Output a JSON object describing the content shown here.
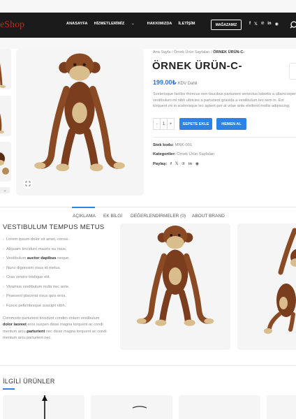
{
  "header": {
    "logo": "eShop",
    "nav": [
      "ANASAYFA",
      "HİZMETLERİMİZ",
      "HAKKIMIZDA",
      "İLETİŞİM"
    ],
    "nav_caret": "⌄",
    "store_button": "MAĞAZAMIZ",
    "socials": [
      "f",
      "𝕏",
      "℗",
      "in",
      "◉"
    ]
  },
  "breadcrumb": {
    "home": "Ana Sayfa",
    "sep1": " / ",
    "category": "Örnek Ürün Sayfaları",
    "sep2": " / ",
    "current": "ÖRNEK ÜRÜN-C-"
  },
  "product": {
    "title": "ÖRNEK ÜRÜN-C-",
    "price": "199.00₺",
    "tax_note": "KDV Dahil",
    "description_lines": [
      "Scelerisque facilisi rhoncus non faucibus parturient senectus lobortis a ullamcorper",
      "vestibulum mi nibh ultricies a parturient gravida a vestibulum leo sem in. Est",
      "torquent mi in scelerisque leo aptent per at vitae ante eleifend mollis adipiscing."
    ],
    "qty_minus": "-",
    "qty_value": "1",
    "qty_plus": "+",
    "add_to_cart": "SEPETE EKLE",
    "buy_now": "HEMEN AL",
    "sku_label": "Stok kodu:",
    "sku_value": "MNK-001",
    "categories_label": "Kategoriler:",
    "categories_value": "Örnek Ürün Sayfaları",
    "share_label": "Paylaş:",
    "share_icons": [
      "f",
      "𝕏",
      "℗",
      "in",
      "◉"
    ],
    "thumb_arrow": "⌄"
  },
  "tabs": [
    "AÇIKLAMA",
    "EK BİLGİ",
    "DEĞERLENDİRMELER (0)",
    "ABOUT BRAND"
  ],
  "description": {
    "title": "VESTIBULUM TEMPUS METUS",
    "features": [
      {
        "text": "Lorem ipsum dolor sit amet, conse."
      },
      {
        "text": "Aliquam tincidunt mauris eu risus."
      },
      {
        "pre": "Vestibulum ",
        "bold": "auctor dapibus",
        "post": " neque."
      },
      {
        "text": "Nunc dignissim risus id metus."
      },
      {
        "text": "Cras ornare tristique elit."
      },
      {
        "text": "Vivamus vestibulum nulla nec ante."
      },
      {
        "text": "Praesent placerat risus quis eros."
      },
      {
        "text": "Fusce pellentesque suscipit nibh."
      }
    ],
    "chevron": "›",
    "paragraph": {
      "l1": "Commodo parturient tincidunt condim entum vestibulum",
      "l2_bold": "dolor laoreet",
      "l2": " eros suspen disse magna torquent ac condi",
      "l3_pre": "mentum arcu ",
      "l3_bold": "parturient",
      "l3_post": " nec disse magna torquent ac condi",
      "l4": "mentum arcu parturient nec."
    }
  },
  "related": {
    "title": "İLGİLİ ÜRÜNLER"
  }
}
